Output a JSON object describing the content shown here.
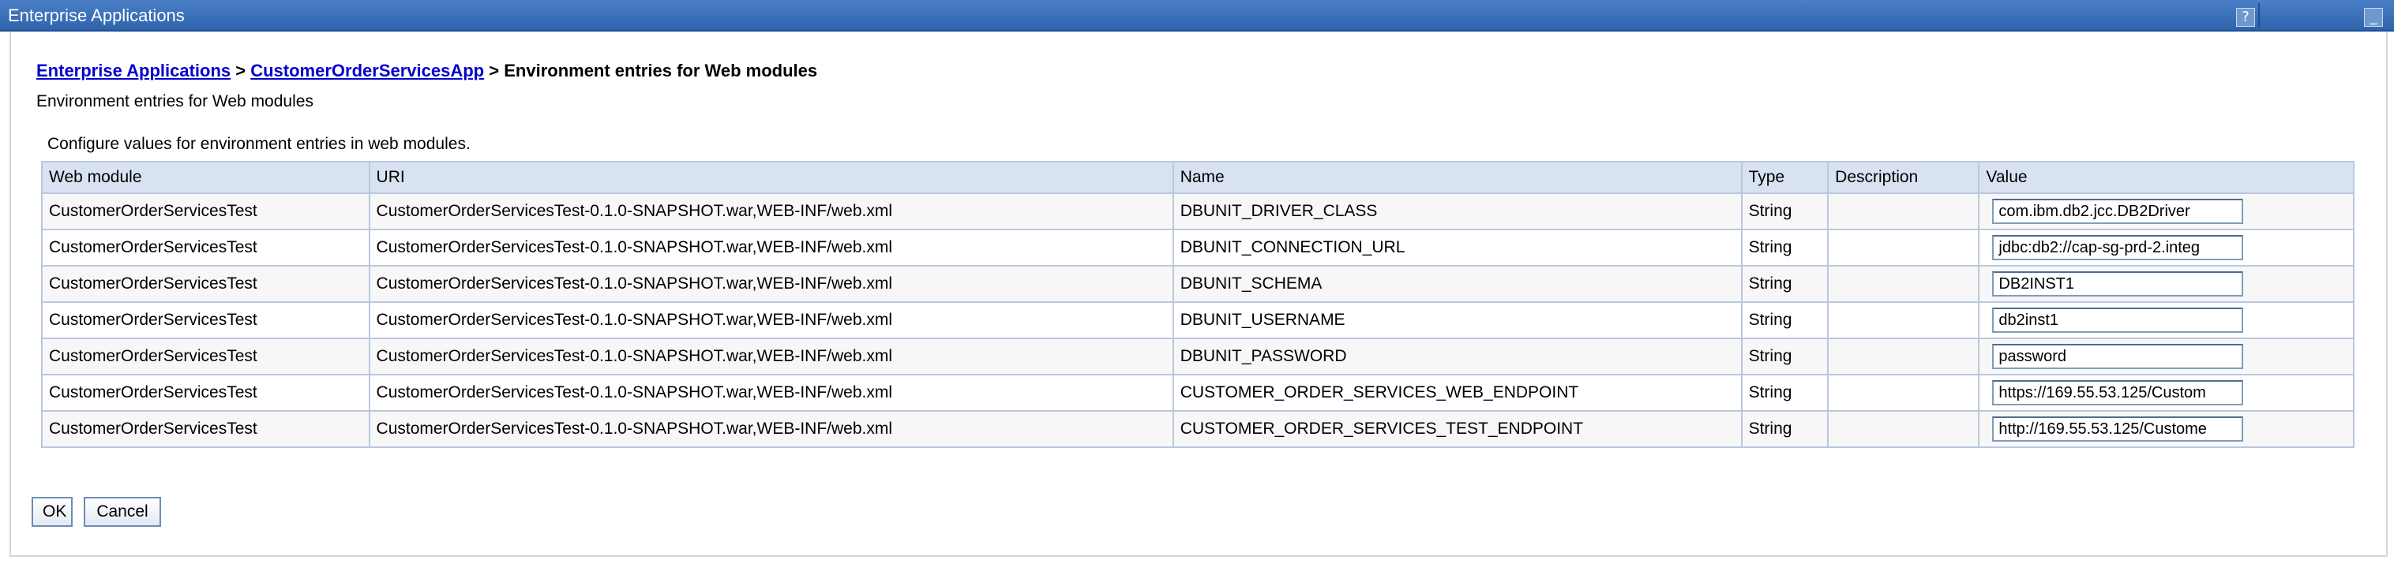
{
  "window": {
    "title": "Enterprise Applications",
    "help_glyph": "?",
    "minimize_glyph": "_"
  },
  "breadcrumb": {
    "items": [
      "Enterprise Applications",
      "CustomerOrderServicesApp"
    ],
    "separator": ">",
    "current": "Environment entries for Web modules"
  },
  "subtitle": "Environment entries for Web modules",
  "description": "Configure values for environment entries in web modules.",
  "table": {
    "columns": [
      "Web module",
      "URI",
      "Name",
      "Type",
      "Description",
      "Value"
    ],
    "rows": [
      {
        "module": "CustomerOrderServicesTest",
        "uri": "CustomerOrderServicesTest-0.1.0-SNAPSHOT.war,WEB-INF/web.xml",
        "name": "DBUNIT_DRIVER_CLASS",
        "type": "String",
        "description": "",
        "value": "com.ibm.db2.jcc.DB2Driver"
      },
      {
        "module": "CustomerOrderServicesTest",
        "uri": "CustomerOrderServicesTest-0.1.0-SNAPSHOT.war,WEB-INF/web.xml",
        "name": "DBUNIT_CONNECTION_URL",
        "type": "String",
        "description": "",
        "value": "jdbc:db2://cap-sg-prd-2.integ"
      },
      {
        "module": "CustomerOrderServicesTest",
        "uri": "CustomerOrderServicesTest-0.1.0-SNAPSHOT.war,WEB-INF/web.xml",
        "name": "DBUNIT_SCHEMA",
        "type": "String",
        "description": "",
        "value": "DB2INST1"
      },
      {
        "module": "CustomerOrderServicesTest",
        "uri": "CustomerOrderServicesTest-0.1.0-SNAPSHOT.war,WEB-INF/web.xml",
        "name": "DBUNIT_USERNAME",
        "type": "String",
        "description": "",
        "value": "db2inst1"
      },
      {
        "module": "CustomerOrderServicesTest",
        "uri": "CustomerOrderServicesTest-0.1.0-SNAPSHOT.war,WEB-INF/web.xml",
        "name": "DBUNIT_PASSWORD",
        "type": "String",
        "description": "",
        "value": "password"
      },
      {
        "module": "CustomerOrderServicesTest",
        "uri": "CustomerOrderServicesTest-0.1.0-SNAPSHOT.war,WEB-INF/web.xml",
        "name": "CUSTOMER_ORDER_SERVICES_WEB_ENDPOINT",
        "type": "String",
        "description": "",
        "value": "https://169.55.53.125/Custom"
      },
      {
        "module": "CustomerOrderServicesTest",
        "uri": "CustomerOrderServicesTest-0.1.0-SNAPSHOT.war,WEB-INF/web.xml",
        "name": "CUSTOMER_ORDER_SERVICES_TEST_ENDPOINT",
        "type": "String",
        "description": "",
        "value": "http://169.55.53.125/Custome"
      }
    ]
  },
  "buttons": {
    "ok": "OK",
    "cancel": "Cancel"
  }
}
